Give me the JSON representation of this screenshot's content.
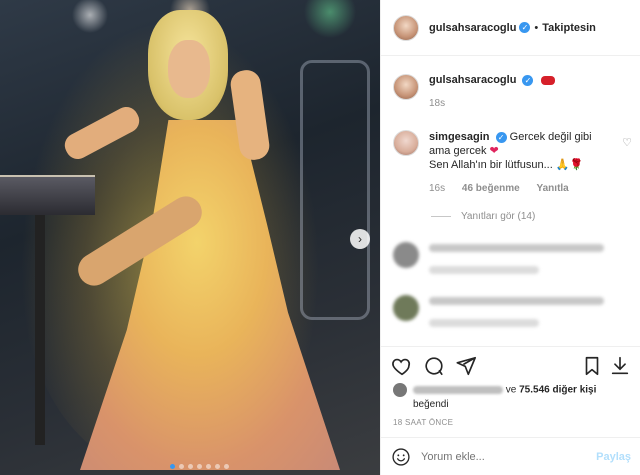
{
  "post": {
    "username": "gulsahsaracoglu",
    "follow_status": "Takiptesin",
    "separator": "•"
  },
  "caption": {
    "username": "gulsahsaracoglu",
    "time": "18s"
  },
  "comment": {
    "username": "simgesagin",
    "text_line1": "Gercek değil gibi",
    "text_line2": "ama gercek",
    "text_line3": "Sen Allah'ın bir lütfusun...",
    "time": "16s",
    "likes": "46 beğenme",
    "reply": "Yanıtla",
    "view_replies": "Yanıtları gör (14)"
  },
  "likes": {
    "text_suffix": "ve",
    "count": "75.546 diğer kişi",
    "liked": "beğendi"
  },
  "time_ago": "18 SAAT ÖNCE",
  "comment_input": {
    "placeholder": "Yorum ekle...",
    "submit": "Paylaş"
  },
  "icons": {
    "verified": "verified-badge-icon",
    "heart": "heart-icon",
    "comment": "comment-icon",
    "share": "send-icon",
    "save": "bookmark-icon",
    "emoji": "smiley-icon",
    "next": "chevron-right-icon"
  },
  "colors": {
    "accent": "#3897f0",
    "muted": "#8e8e8e",
    "share_disabled": "#b2dffc"
  }
}
